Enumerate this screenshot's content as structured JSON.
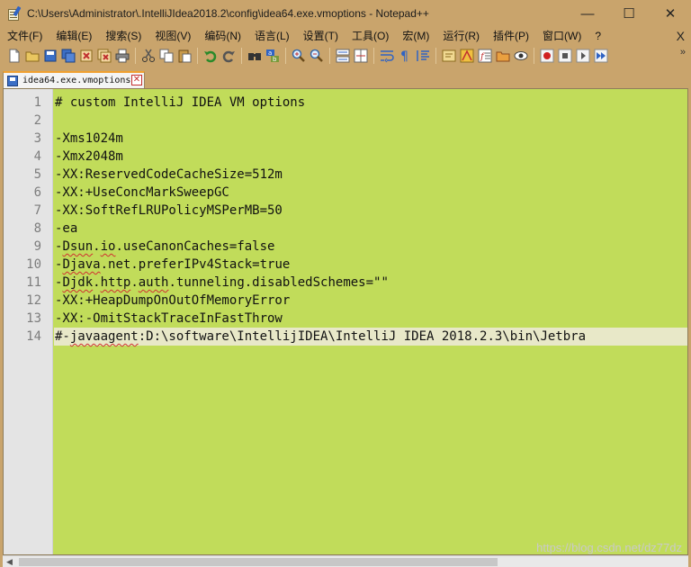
{
  "window": {
    "title": "C:\\Users\\Administrator\\.IntelliJIdea2018.2\\config\\idea64.exe.vmoptions - Notepad++",
    "minimize": "—",
    "maximize": "☐",
    "close": "✕"
  },
  "menu": {
    "items": [
      "文件(F)",
      "编辑(E)",
      "搜索(S)",
      "视图(V)",
      "编码(N)",
      "语言(L)",
      "设置(T)",
      "工具(O)",
      "宏(M)",
      "运行(R)",
      "插件(P)",
      "窗口(W)",
      "?"
    ],
    "close": "X"
  },
  "toolbar": {
    "overflow": "»",
    "icons": [
      "new-file-icon",
      "open-file-icon",
      "save-icon",
      "save-all-icon",
      "close-icon",
      "close-all-icon",
      "print-icon",
      "cut-icon",
      "copy-icon",
      "paste-icon",
      "undo-icon",
      "redo-icon",
      "find-icon",
      "replace-icon",
      "zoom-in-icon",
      "zoom-out-icon",
      "sync-vertical-icon",
      "sync-horizontal-icon",
      "word-wrap-icon",
      "show-all-chars-icon",
      "indent-guide-icon",
      "user-language-icon",
      "document-map-icon",
      "function-list-icon",
      "folder-workspace-icon",
      "monitoring-icon",
      "record-macro-icon",
      "stop-macro-icon",
      "play-macro-icon",
      "run-macro-multiple-icon"
    ]
  },
  "tab": {
    "label": "idea64.exe.vmoptions",
    "close": "✕"
  },
  "editor": {
    "lines": [
      "# custom IntelliJ IDEA VM options",
      "",
      "-Xms1024m",
      "-Xmx2048m",
      "-XX:ReservedCodeCacheSize=512m",
      "-XX:+UseConcMarkSweepGC",
      "-XX:SoftRefLRUPolicyMSPerMB=50",
      "-ea",
      "-Dsun.io.useCanonCaches=false",
      "-Djava.net.preferIPv4Stack=true",
      "-Djdk.http.auth.tunneling.disabledSchemes=\"\"",
      "-XX:+HeapDumpOnOutOfMemoryError",
      "-XX:-OmitStackTraceInFastThrow",
      "#-javaagent:D:\\software\\IntellijIDEA\\IntelliJ IDEA 2018.2.3\\bin\\Jetbra"
    ],
    "line_numbers": [
      "1",
      "2",
      "3",
      "4",
      "5",
      "6",
      "7",
      "8",
      "9",
      "10",
      "11",
      "12",
      "13",
      "14"
    ],
    "current_line": 14
  },
  "scrollbar": {
    "left_arrow": "◀"
  },
  "watermark": "https://blog.csdn.net/dz77dz",
  "colors": {
    "chrome": "#c9a46c",
    "editor_background": "#c1dc5a",
    "current_line": "#e8e8c8",
    "gutter": "#e4e4e4"
  }
}
